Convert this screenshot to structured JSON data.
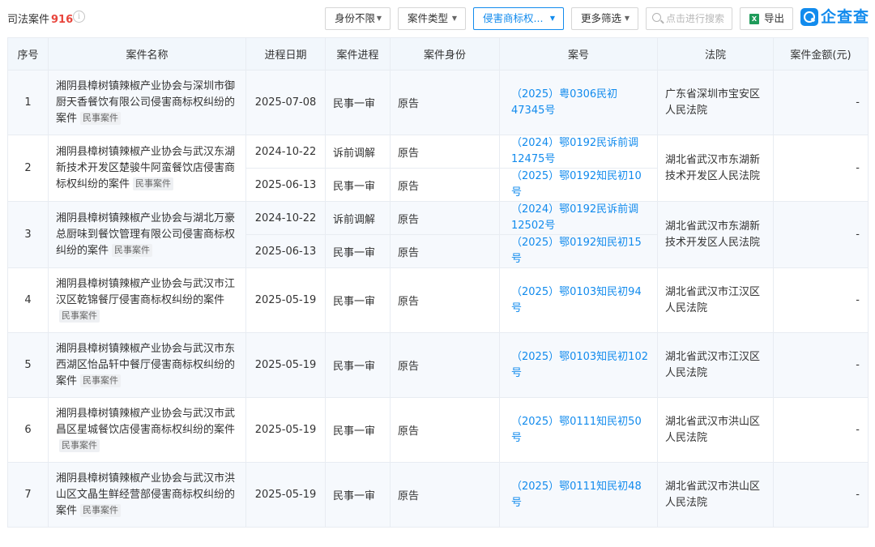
{
  "header": {
    "title": "司法案件",
    "count": "916",
    "info_icon": "i",
    "filters": {
      "identity": "身份不限",
      "case_type": "案件类型",
      "cause": "侵害商标权...",
      "more": "更多筛选"
    },
    "search_placeholder": "点击进行搜索",
    "export_label": "导出",
    "logo_text": "企查查"
  },
  "columns": {
    "idx": "序号",
    "name": "案件名称",
    "date": "进程日期",
    "stage": "案件进程",
    "role": "案件身份",
    "caseno": "案号",
    "court": "法院",
    "amount": "案件金额(元)"
  },
  "rows": [
    {
      "idx": "1",
      "name": "湘阴县樟树镇辣椒产业协会与深圳市御厨天香餐饮有限公司侵害商标权纠纷的案件",
      "tag": "民事案件",
      "court": "广东省深圳市宝安区人民法院",
      "amount": "-",
      "progress": [
        {
          "date": "2025-07-08",
          "stage": "民事一审",
          "role": "原告",
          "caseno": "（2025）粤0306民初47345号"
        }
      ]
    },
    {
      "idx": "2",
      "name": "湘阴县樟树镇辣椒产业协会与武汉东湖新技术开发区楚骏牛阿蛮餐饮店侵害商标权纠纷的案件",
      "tag": "民事案件",
      "court": "湖北省武汉市东湖新技术开发区人民法院",
      "amount": "-",
      "progress": [
        {
          "date": "2024-10-22",
          "stage": "诉前调解",
          "role": "原告",
          "caseno": "（2024）鄂0192民诉前调12475号"
        },
        {
          "date": "2025-06-13",
          "stage": "民事一审",
          "role": "原告",
          "caseno": "（2025）鄂0192知民初10号"
        }
      ]
    },
    {
      "idx": "3",
      "name": "湘阴县樟树镇辣椒产业协会与湖北万豪总厨味到餐饮管理有限公司侵害商标权纠纷的案件",
      "tag": "民事案件",
      "court": "湖北省武汉市东湖新技术开发区人民法院",
      "amount": "-",
      "progress": [
        {
          "date": "2024-10-22",
          "stage": "诉前调解",
          "role": "原告",
          "caseno": "（2024）鄂0192民诉前调12502号"
        },
        {
          "date": "2025-06-13",
          "stage": "民事一审",
          "role": "原告",
          "caseno": "（2025）鄂0192知民初15号"
        }
      ]
    },
    {
      "idx": "4",
      "name": "湘阴县樟树镇辣椒产业协会与武汉市江汉区乾锦餐厅侵害商标权纠纷的案件",
      "tag": "民事案件",
      "court": "湖北省武汉市江汉区人民法院",
      "amount": "-",
      "progress": [
        {
          "date": "2025-05-19",
          "stage": "民事一审",
          "role": "原告",
          "caseno": "（2025）鄂0103知民初94号"
        }
      ]
    },
    {
      "idx": "5",
      "name": "湘阴县樟树镇辣椒产业协会与武汉市东西湖区怡品轩中餐厅侵害商标权纠纷的案件",
      "tag": "民事案件",
      "court": "湖北省武汉市江汉区人民法院",
      "amount": "-",
      "progress": [
        {
          "date": "2025-05-19",
          "stage": "民事一审",
          "role": "原告",
          "caseno": "（2025）鄂0103知民初102号"
        }
      ]
    },
    {
      "idx": "6",
      "name": "湘阴县樟树镇辣椒产业协会与武汉市武昌区星城餐饮店侵害商标权纠纷的案件",
      "tag": "民事案件",
      "court": "湖北省武汉市洪山区人民法院",
      "amount": "-",
      "progress": [
        {
          "date": "2025-05-19",
          "stage": "民事一审",
          "role": "原告",
          "caseno": "（2025）鄂0111知民初50号"
        }
      ]
    },
    {
      "idx": "7",
      "name": "湘阴县樟树镇辣椒产业协会与武汉市洪山区文晶生鲜经营部侵害商标权纠纷的案件",
      "tag": "民事案件",
      "court": "湖北省武汉市洪山区人民法院",
      "amount": "-",
      "progress": [
        {
          "date": "2025-05-19",
          "stage": "民事一审",
          "role": "原告",
          "caseno": "（2025）鄂0111知民初48号"
        }
      ]
    }
  ]
}
